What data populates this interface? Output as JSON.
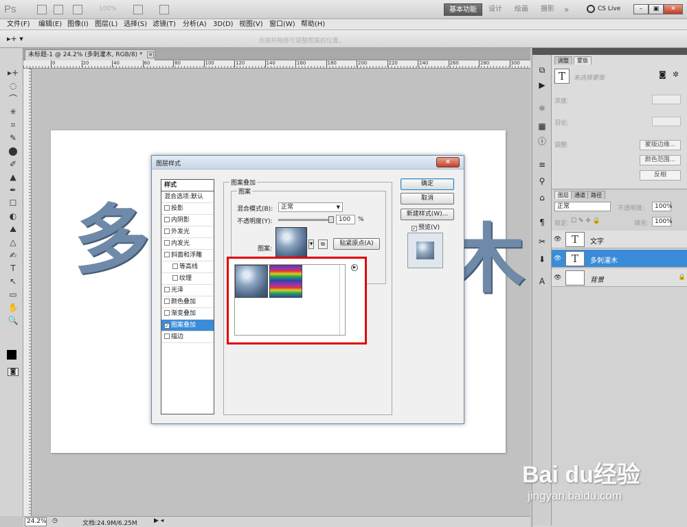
{
  "app": {
    "logo": "Ps",
    "zoom_display": "100%",
    "workspaces": [
      "基本功能",
      "设计",
      "绘画",
      "摄影"
    ],
    "more_workspaces": "»",
    "cs_live": "CS Live",
    "win_buttons": [
      "–",
      "▣",
      "✕"
    ]
  },
  "menu": [
    "文件(F)",
    "编辑(E)",
    "图像(I)",
    "图层(L)",
    "选择(S)",
    "滤镜(T)",
    "分析(A)",
    "3D(D)",
    "视图(V)",
    "窗口(W)",
    "帮助(H)"
  ],
  "options_bar": {
    "hint": "点按并拖移可调整图案的位置。"
  },
  "document": {
    "tab_title": "未标题-1 @ 24.2% (多刺灌木, RGB/8) *",
    "tab_close": "✕",
    "canvas_text_left": "多",
    "canvas_text_right": "木"
  },
  "ruler": {
    "top_labels": [
      "0",
      "20",
      "40",
      "60",
      "80",
      "100",
      "120",
      "140",
      "160",
      "180",
      "200",
      "220",
      "240",
      "260",
      "280",
      "300"
    ]
  },
  "status": {
    "zoom": "24.2%",
    "doc": "文档:24.9M/6.25M"
  },
  "tools": [
    "▸+",
    "◌",
    "⌒",
    "✳",
    "⌗",
    "✎",
    "⬤",
    "✐",
    "▲",
    "✒",
    "☐",
    "◐",
    "⛰",
    "△",
    "✍",
    "T",
    "↖",
    "▭",
    "✋",
    "🔍"
  ],
  "right_panel": {
    "tabs_top": [
      "调整",
      "蒙版"
    ],
    "mask_text": "未选择蒙版",
    "density_label": "浓度:",
    "feather_label": "羽化:",
    "refine_label": "调整:",
    "buttons": [
      "蒙版边缘...",
      "颜色范围...",
      "反相"
    ],
    "tabs_layers": [
      "图层",
      "通道",
      "路径"
    ],
    "blend_mode": "正常",
    "opacity_label": "不透明度:",
    "opacity_value": "100%",
    "lock_label": "锁定:",
    "fill_label": "填充:",
    "fill_value": "100%",
    "layers": [
      {
        "name": "文字",
        "thumb": "T"
      },
      {
        "name": "多刺灌木",
        "thumb": "T"
      },
      {
        "name": "背景",
        "thumb": ""
      }
    ],
    "strip_icons": [
      "⧉",
      "▶",
      "☼",
      "▦",
      "ⓘ",
      "≡",
      "⚲",
      "⌂",
      "¶",
      "✂",
      "⬇",
      "A"
    ]
  },
  "dialog": {
    "title": "图层样式",
    "close": "✕",
    "styles_header": "样式",
    "blend_default": "混合选项:默认",
    "styles": [
      {
        "label": "投影",
        "checked": false,
        "indent": false
      },
      {
        "label": "内阴影",
        "checked": false,
        "indent": false
      },
      {
        "label": "外发光",
        "checked": false,
        "indent": false
      },
      {
        "label": "内发光",
        "checked": false,
        "indent": false
      },
      {
        "label": "斜面和浮雕",
        "checked": false,
        "indent": false
      },
      {
        "label": "等高线",
        "checked": false,
        "indent": true
      },
      {
        "label": "纹理",
        "checked": false,
        "indent": true
      },
      {
        "label": "光泽",
        "checked": false,
        "indent": false
      },
      {
        "label": "颜色叠加",
        "checked": false,
        "indent": false
      },
      {
        "label": "渐变叠加",
        "checked": false,
        "indent": false
      },
      {
        "label": "图案叠加",
        "checked": true,
        "indent": false
      },
      {
        "label": "描边",
        "checked": false,
        "indent": false
      }
    ],
    "group_title": "图案叠加",
    "subgroup_title": "图案",
    "blend_mode_label": "混合模式(B):",
    "blend_mode_value": "正常",
    "opacity_label": "不透明度(Y):",
    "opacity_value": "100",
    "opacity_unit": "%",
    "opacity_level": 1.0,
    "pattern_label": "图案:",
    "snap_button": "贴紧原点(A)",
    "ok": "确定",
    "cancel": "取消",
    "new_style": "新建样式(W)...",
    "preview_label": "预览(V)",
    "preview_checked": true
  },
  "watermark": {
    "brand": "Bai du经验",
    "url": "jingyan.baidu.com"
  }
}
